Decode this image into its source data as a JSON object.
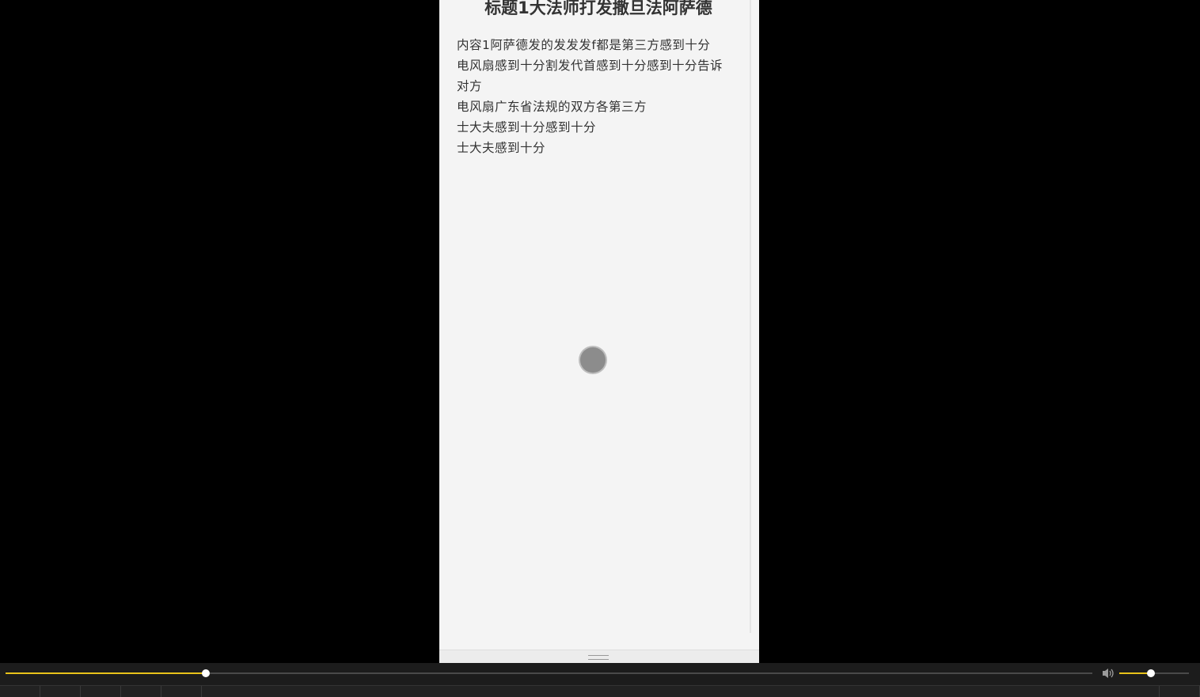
{
  "phone": {
    "title": "标题1大法师打发撒旦法阿萨德",
    "content_lines": [
      "内容1阿萨德发的发发发f都是第三方感到十分",
      "电风扇感到十分割发代首感到十分感到十分告诉对方",
      "电风扇广东省法规的双方各第三方",
      "士大夫感到十分感到十分",
      "士大夫感到十分"
    ]
  },
  "player": {
    "seek_progress": 0.184,
    "volume_level": 0.45,
    "icons": {
      "volume": "speaker-icon",
      "handle": "drag-handle-icon"
    },
    "colors": {
      "accent": "#e8c21a",
      "background": "#000000",
      "bar": "#1c1c1c"
    }
  }
}
